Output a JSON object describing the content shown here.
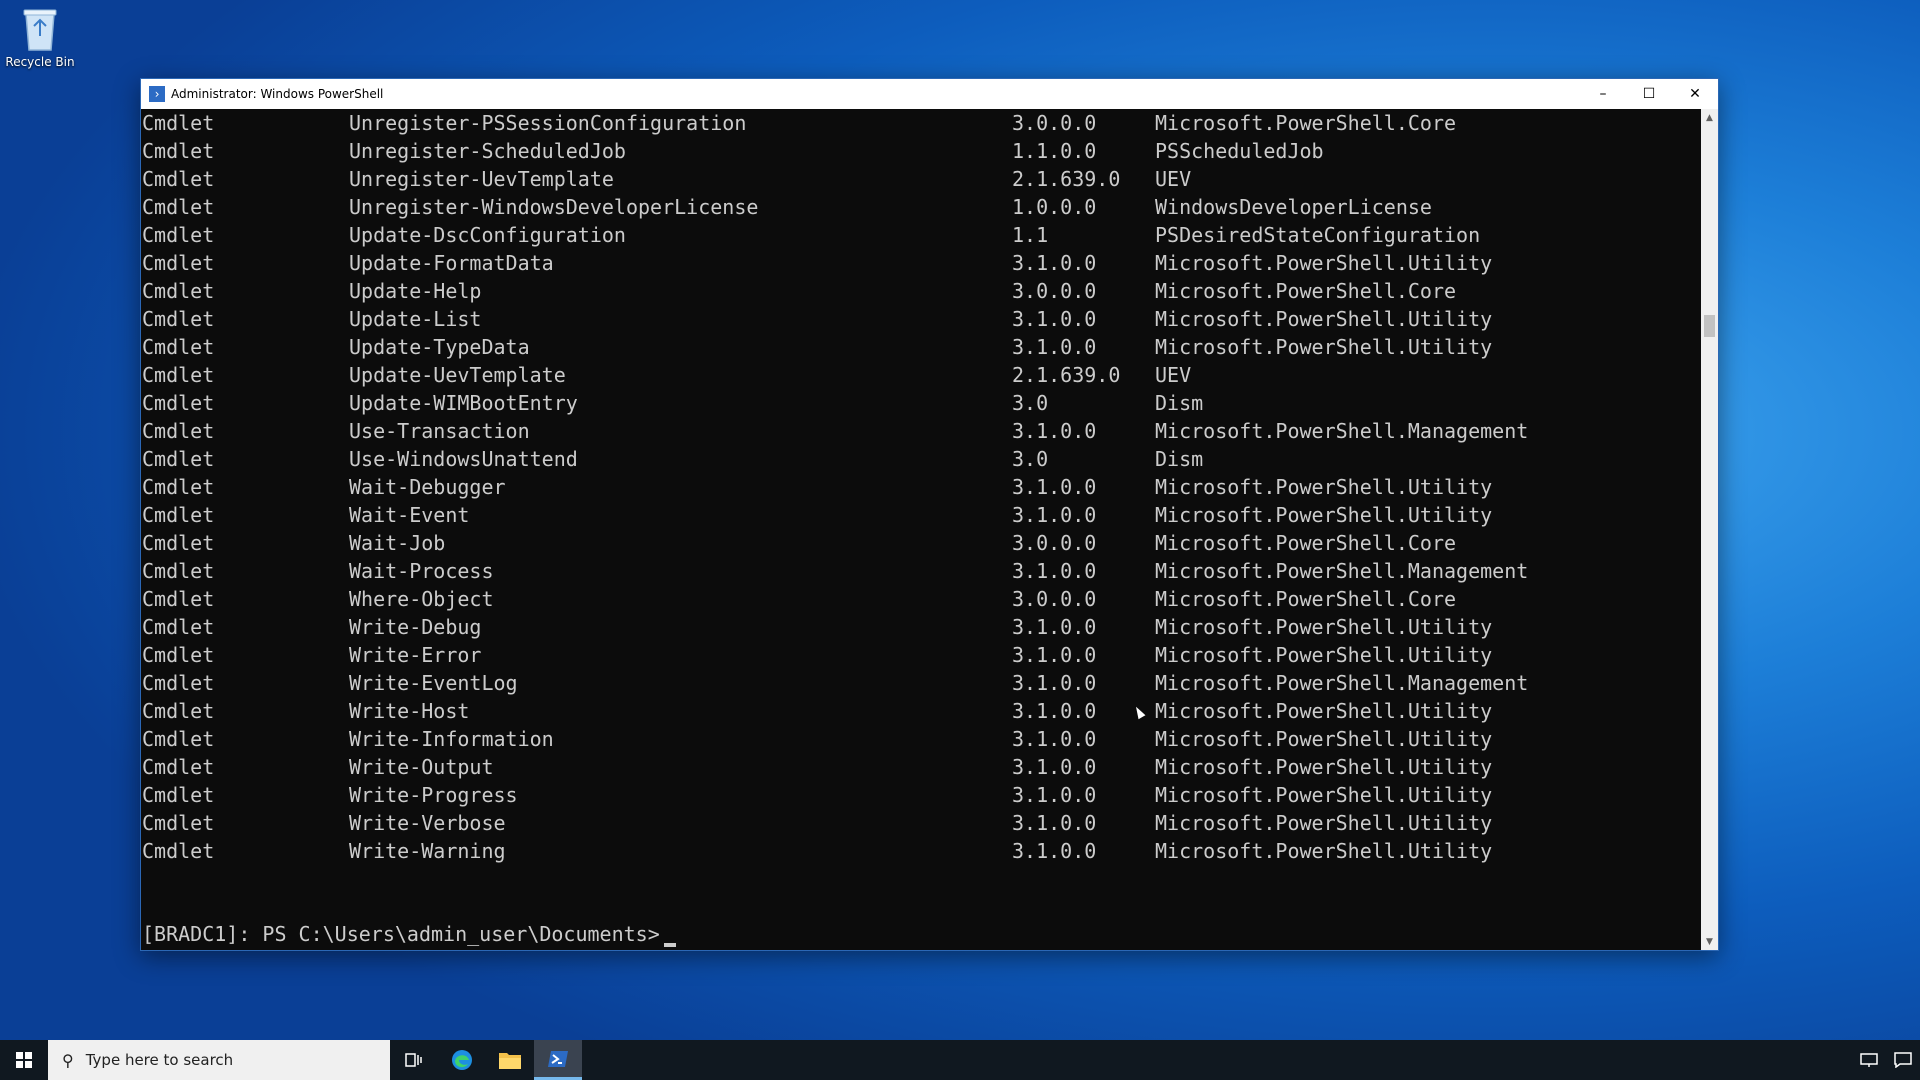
{
  "desktop": {
    "recycle_bin_label": "Recycle Bin"
  },
  "window": {
    "title": "Administrator: Windows PowerShell",
    "buttons": {
      "minimize": "–",
      "maximize": "☐",
      "close": "✕"
    }
  },
  "console": {
    "rows": [
      {
        "type": "Cmdlet",
        "name": "Unregister-PSSessionConfiguration",
        "version": "3.0.0.0",
        "source": "Microsoft.PowerShell.Core"
      },
      {
        "type": "Cmdlet",
        "name": "Unregister-ScheduledJob",
        "version": "1.1.0.0",
        "source": "PSScheduledJob"
      },
      {
        "type": "Cmdlet",
        "name": "Unregister-UevTemplate",
        "version": "2.1.639.0",
        "source": "UEV"
      },
      {
        "type": "Cmdlet",
        "name": "Unregister-WindowsDeveloperLicense",
        "version": "1.0.0.0",
        "source": "WindowsDeveloperLicense"
      },
      {
        "type": "Cmdlet",
        "name": "Update-DscConfiguration",
        "version": "1.1",
        "source": "PSDesiredStateConfiguration"
      },
      {
        "type": "Cmdlet",
        "name": "Update-FormatData",
        "version": "3.1.0.0",
        "source": "Microsoft.PowerShell.Utility"
      },
      {
        "type": "Cmdlet",
        "name": "Update-Help",
        "version": "3.0.0.0",
        "source": "Microsoft.PowerShell.Core"
      },
      {
        "type": "Cmdlet",
        "name": "Update-List",
        "version": "3.1.0.0",
        "source": "Microsoft.PowerShell.Utility"
      },
      {
        "type": "Cmdlet",
        "name": "Update-TypeData",
        "version": "3.1.0.0",
        "source": "Microsoft.PowerShell.Utility"
      },
      {
        "type": "Cmdlet",
        "name": "Update-UevTemplate",
        "version": "2.1.639.0",
        "source": "UEV"
      },
      {
        "type": "Cmdlet",
        "name": "Update-WIMBootEntry",
        "version": "3.0",
        "source": "Dism"
      },
      {
        "type": "Cmdlet",
        "name": "Use-Transaction",
        "version": "3.1.0.0",
        "source": "Microsoft.PowerShell.Management"
      },
      {
        "type": "Cmdlet",
        "name": "Use-WindowsUnattend",
        "version": "3.0",
        "source": "Dism"
      },
      {
        "type": "Cmdlet",
        "name": "Wait-Debugger",
        "version": "3.1.0.0",
        "source": "Microsoft.PowerShell.Utility"
      },
      {
        "type": "Cmdlet",
        "name": "Wait-Event",
        "version": "3.1.0.0",
        "source": "Microsoft.PowerShell.Utility"
      },
      {
        "type": "Cmdlet",
        "name": "Wait-Job",
        "version": "3.0.0.0",
        "source": "Microsoft.PowerShell.Core"
      },
      {
        "type": "Cmdlet",
        "name": "Wait-Process",
        "version": "3.1.0.0",
        "source": "Microsoft.PowerShell.Management"
      },
      {
        "type": "Cmdlet",
        "name": "Where-Object",
        "version": "3.0.0.0",
        "source": "Microsoft.PowerShell.Core"
      },
      {
        "type": "Cmdlet",
        "name": "Write-Debug",
        "version": "3.1.0.0",
        "source": "Microsoft.PowerShell.Utility"
      },
      {
        "type": "Cmdlet",
        "name": "Write-Error",
        "version": "3.1.0.0",
        "source": "Microsoft.PowerShell.Utility"
      },
      {
        "type": "Cmdlet",
        "name": "Write-EventLog",
        "version": "3.1.0.0",
        "source": "Microsoft.PowerShell.Management"
      },
      {
        "type": "Cmdlet",
        "name": "Write-Host",
        "version": "3.1.0.0",
        "source": "Microsoft.PowerShell.Utility"
      },
      {
        "type": "Cmdlet",
        "name": "Write-Information",
        "version": "3.1.0.0",
        "source": "Microsoft.PowerShell.Utility"
      },
      {
        "type": "Cmdlet",
        "name": "Write-Output",
        "version": "3.1.0.0",
        "source": "Microsoft.PowerShell.Utility"
      },
      {
        "type": "Cmdlet",
        "name": "Write-Progress",
        "version": "3.1.0.0",
        "source": "Microsoft.PowerShell.Utility"
      },
      {
        "type": "Cmdlet",
        "name": "Write-Verbose",
        "version": "3.1.0.0",
        "source": "Microsoft.PowerShell.Utility"
      },
      {
        "type": "Cmdlet",
        "name": "Write-Warning",
        "version": "3.1.0.0",
        "source": "Microsoft.PowerShell.Utility"
      }
    ],
    "prompt": "[BRADC1]: PS C:\\Users\\admin_user\\Documents>"
  },
  "taskbar": {
    "search_placeholder": "Type here to search"
  },
  "colors": {
    "console_bg": "#0c0c0c",
    "console_fg": "#cccccc",
    "taskbar_bg": "#101820",
    "accent": "#76b9ed"
  }
}
